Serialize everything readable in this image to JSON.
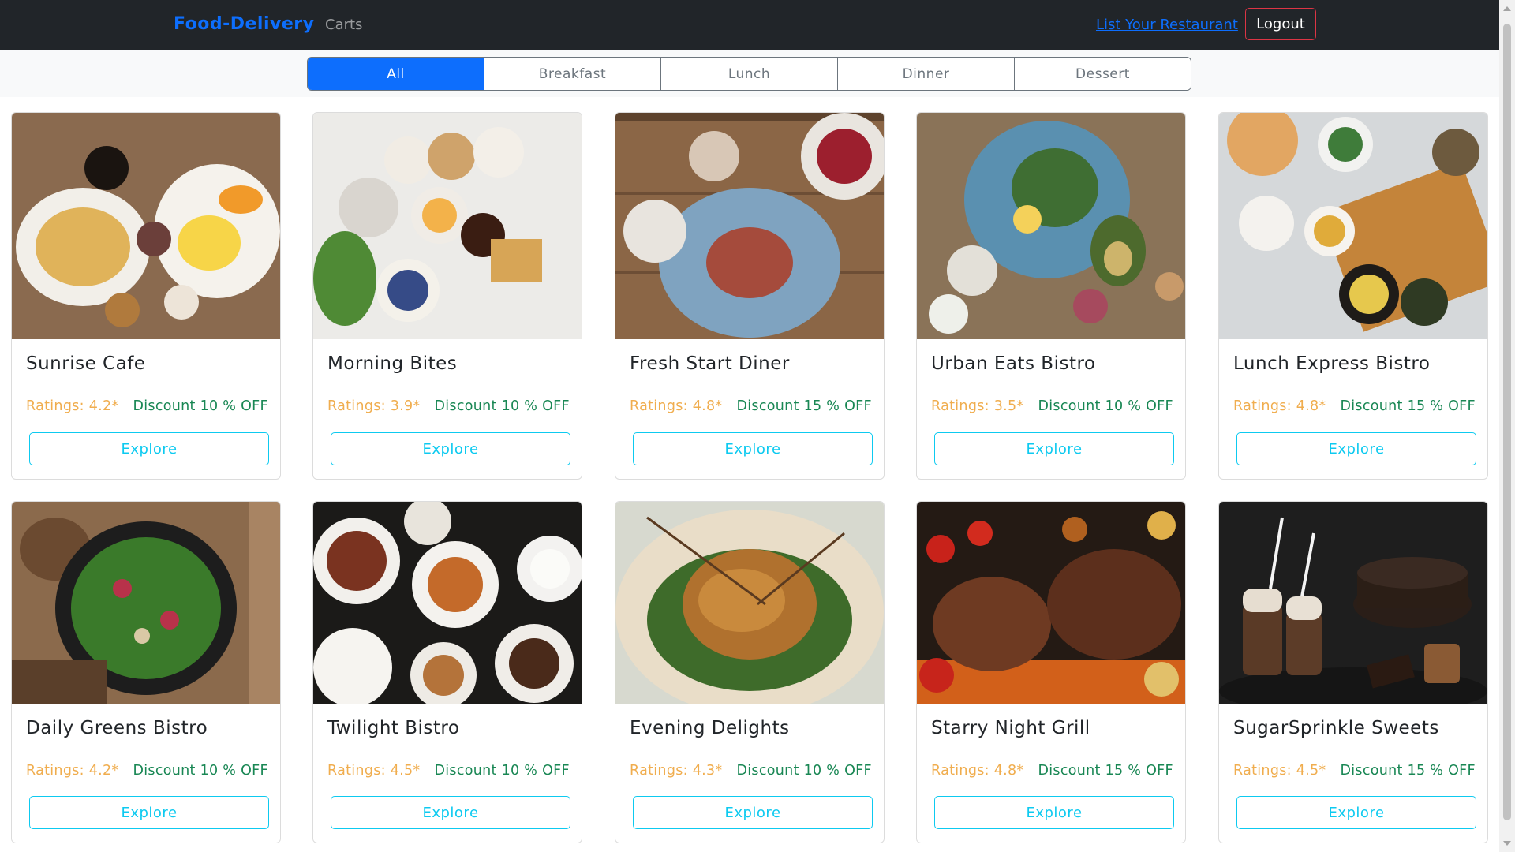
{
  "navbar": {
    "brand": "Food-Delivery",
    "carts_link": "Carts",
    "list_restaurant_link": "List Your Restaurant",
    "logout_button": "Logout"
  },
  "categories": {
    "tabs": [
      {
        "label": "All",
        "active": true
      },
      {
        "label": "Breakfast",
        "active": false
      },
      {
        "label": "Lunch",
        "active": false
      },
      {
        "label": "Dinner",
        "active": false
      },
      {
        "label": "Dessert",
        "active": false
      }
    ]
  },
  "restaurants": [
    {
      "name": "Sunrise Cafe",
      "rating": "Ratings: 4.2*",
      "discount": "Discount 10 % OFF",
      "button": "Explore"
    },
    {
      "name": "Morning Bites",
      "rating": "Ratings: 3.9*",
      "discount": "Discount 10 % OFF",
      "button": "Explore"
    },
    {
      "name": "Fresh Start Diner",
      "rating": "Ratings: 4.8*",
      "discount": "Discount 15 % OFF",
      "button": "Explore"
    },
    {
      "name": "Urban Eats Bistro",
      "rating": "Ratings: 3.5*",
      "discount": "Discount 10 % OFF",
      "button": "Explore"
    },
    {
      "name": "Lunch Express Bistro",
      "rating": "Ratings: 4.8*",
      "discount": "Discount 15 % OFF",
      "button": "Explore"
    },
    {
      "name": "Daily Greens Bistro",
      "rating": "Ratings: 4.2*",
      "discount": "Discount 10 % OFF",
      "button": "Explore"
    },
    {
      "name": "Twilight Bistro",
      "rating": "Ratings: 4.5*",
      "discount": "Discount 10 % OFF",
      "button": "Explore"
    },
    {
      "name": "Evening Delights",
      "rating": "Ratings: 4.3*",
      "discount": "Discount 10 % OFF",
      "button": "Explore"
    },
    {
      "name": "Starry Night Grill",
      "rating": "Ratings: 4.8*",
      "discount": "Discount 15 % OFF",
      "button": "Explore"
    },
    {
      "name": "SugarSprinkle Sweets",
      "rating": "Ratings: 4.5*",
      "discount": "Discount 15 % OFF",
      "button": "Explore"
    }
  ],
  "colors": {
    "navbar_bg": "#212529",
    "brand": "#0d6efd",
    "active_tab": "#0d6efd",
    "rating": "#f0ad4e",
    "discount": "#198754",
    "explore_outline": "#0dcaf0",
    "logout_outline": "#dc3545"
  }
}
